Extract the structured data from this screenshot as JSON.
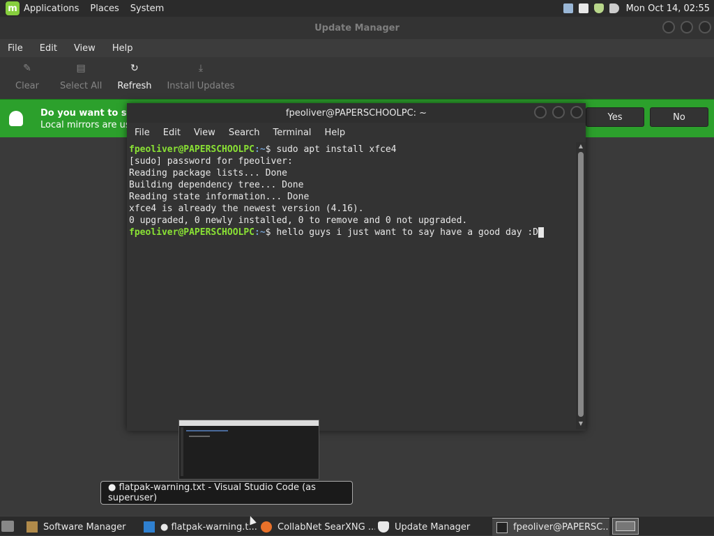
{
  "top_panel": {
    "menus": [
      "Applications",
      "Places",
      "System"
    ],
    "clock": "Mon Oct 14, 02:55"
  },
  "update_manager": {
    "title": "Update Manager",
    "menus": [
      "File",
      "Edit",
      "View",
      "Help"
    ],
    "toolbar": {
      "clear": "Clear",
      "select_all": "Select All",
      "refresh": "Refresh",
      "install": "Install Updates"
    },
    "infobar": {
      "question": "Do you want to swit",
      "detail": "Local mirrors are usu",
      "yes": "Yes",
      "no": "No"
    }
  },
  "terminal": {
    "title": "fpeoliver@PAPERSCHOOLPC: ~",
    "menus": [
      "File",
      "Edit",
      "View",
      "Search",
      "Terminal",
      "Help"
    ],
    "user_host": "fpeoliver@PAPERSCHOOLPC",
    "path_1": ":~",
    "command_1": "$ sudo apt install xfce4",
    "output": [
      "[sudo] password for fpeoliver:",
      "Reading package lists... Done",
      "Building dependency tree... Done",
      "Reading state information... Done",
      "xfce4 is already the newest version (4.16).",
      "0 upgraded, 0 newly installed, 0 to remove and 0 not upgraded."
    ],
    "path_2": ":~",
    "command_2": "$ hello guys i just want to say have a good day :D"
  },
  "tooltip": {
    "text": "● flatpak-warning.txt - Visual Studio Code (as superuser)"
  },
  "taskbar": {
    "tasks": [
      "Software Manager",
      "● flatpak-warning.t...",
      "CollabNet SearXNG ...",
      "Update Manager",
      "fpeoliver@PAPERSC..."
    ]
  },
  "colors": {
    "prompt_user": "#8ae234",
    "prompt_path": "#729fcf",
    "infobar": "#2ca02c"
  }
}
